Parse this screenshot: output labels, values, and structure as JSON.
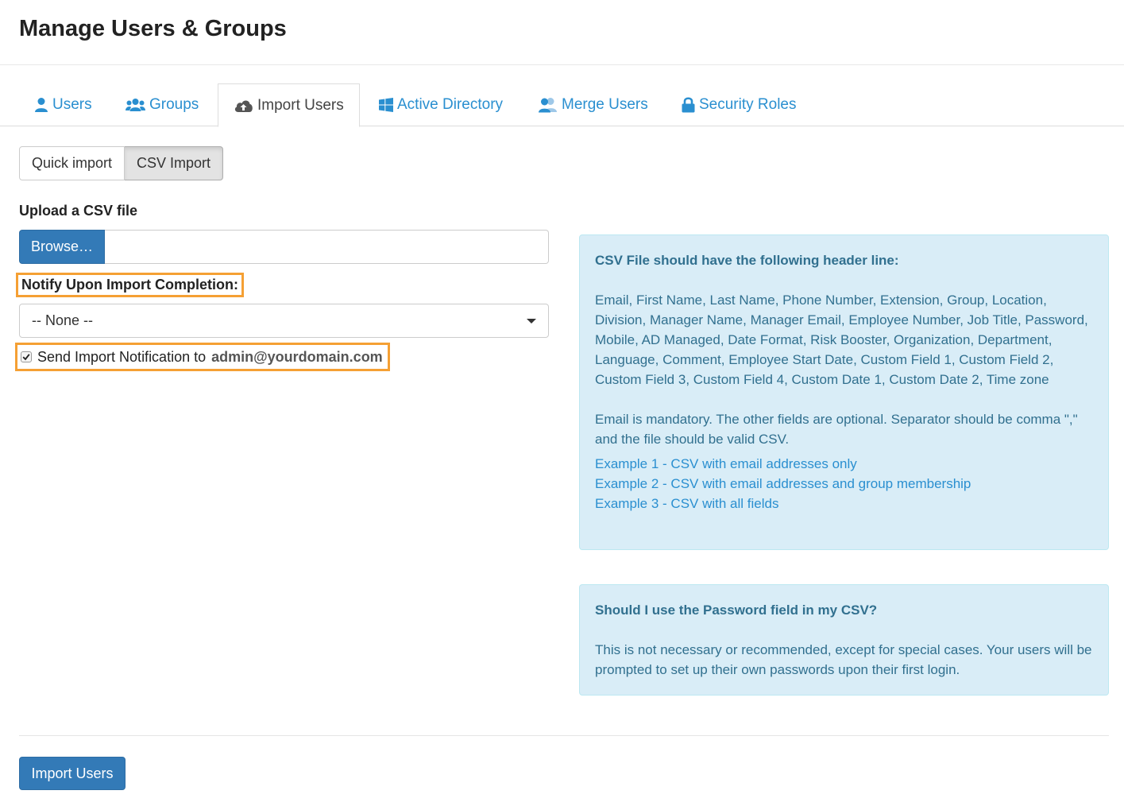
{
  "page": {
    "title": "Manage Users & Groups"
  },
  "tabs": [
    {
      "label": "Users",
      "icon": "user-icon",
      "active": false
    },
    {
      "label": "Groups",
      "icon": "users-icon",
      "active": false
    },
    {
      "label": "Import Users",
      "icon": "cloud-upload-icon",
      "active": true
    },
    {
      "label": "Active Directory",
      "icon": "windows-icon",
      "active": false
    },
    {
      "label": "Merge Users",
      "icon": "merge-users-icon",
      "active": false
    },
    {
      "label": "Security Roles",
      "icon": "lock-icon",
      "active": false
    }
  ],
  "import_mode": {
    "options": [
      "Quick import",
      "CSV Import"
    ],
    "selected": "CSV Import"
  },
  "upload": {
    "label": "Upload a CSV file",
    "browse_label": "Browse…",
    "file_value": ""
  },
  "notify": {
    "label": "Notify Upon Import Completion:",
    "selected": "-- None --",
    "checkbox_label": "Send Import Notification to",
    "checkbox_checked": true,
    "email": "admin@yourdomain.com"
  },
  "info_header": {
    "title": "CSV File should have the following header line:",
    "fields_line": "Email, First Name, Last Name, Phone Number, Extension, Group, Location, Division, Manager Name, Manager Email, Employee Number, Job Title, Password, Mobile, AD Managed, Date Format, Risk Booster, Organization, Department, Language, Comment, Employee Start Date, Custom Field 1, Custom Field 2, Custom Field 3, Custom Field 4, Custom Date 1, Custom Date 2, Time zone",
    "note": "Email is mandatory. The other fields are optional. Separator should be comma \",\" and the file should be valid CSV.",
    "examples": [
      "Example 1 - CSV with email addresses only",
      "Example 2 - CSV with email addresses and group membership",
      "Example 3 - CSV with all fields"
    ]
  },
  "info_password": {
    "title": "Should I use the Password field in my CSV?",
    "text": "This is not necessary or recommended, except for special cases. Your users will be prompted to set up their own passwords upon their first login."
  },
  "actions": {
    "import_label": "Import Users"
  },
  "colors": {
    "link": "#2a8fd0",
    "primary": "#337ab7",
    "info_bg": "#d9edf7",
    "info_text": "#31708f",
    "highlight": "#f5a034"
  }
}
